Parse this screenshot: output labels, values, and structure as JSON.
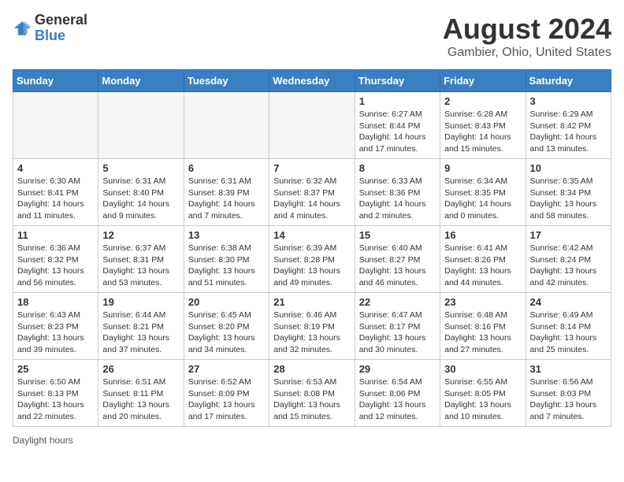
{
  "header": {
    "logo_general": "General",
    "logo_blue": "Blue",
    "main_title": "August 2024",
    "subtitle": "Gambier, Ohio, United States"
  },
  "footer": {
    "label": "Daylight hours"
  },
  "days_of_week": [
    "Sunday",
    "Monday",
    "Tuesday",
    "Wednesday",
    "Thursday",
    "Friday",
    "Saturday"
  ],
  "weeks": [
    [
      {
        "day": "",
        "info": ""
      },
      {
        "day": "",
        "info": ""
      },
      {
        "day": "",
        "info": ""
      },
      {
        "day": "",
        "info": ""
      },
      {
        "day": "1",
        "info": "Sunrise: 6:27 AM\nSunset: 8:44 PM\nDaylight: 14 hours and 17 minutes."
      },
      {
        "day": "2",
        "info": "Sunrise: 6:28 AM\nSunset: 8:43 PM\nDaylight: 14 hours and 15 minutes."
      },
      {
        "day": "3",
        "info": "Sunrise: 6:29 AM\nSunset: 8:42 PM\nDaylight: 14 hours and 13 minutes."
      }
    ],
    [
      {
        "day": "4",
        "info": "Sunrise: 6:30 AM\nSunset: 8:41 PM\nDaylight: 14 hours and 11 minutes."
      },
      {
        "day": "5",
        "info": "Sunrise: 6:31 AM\nSunset: 8:40 PM\nDaylight: 14 hours and 9 minutes."
      },
      {
        "day": "6",
        "info": "Sunrise: 6:31 AM\nSunset: 8:39 PM\nDaylight: 14 hours and 7 minutes."
      },
      {
        "day": "7",
        "info": "Sunrise: 6:32 AM\nSunset: 8:37 PM\nDaylight: 14 hours and 4 minutes."
      },
      {
        "day": "8",
        "info": "Sunrise: 6:33 AM\nSunset: 8:36 PM\nDaylight: 14 hours and 2 minutes."
      },
      {
        "day": "9",
        "info": "Sunrise: 6:34 AM\nSunset: 8:35 PM\nDaylight: 14 hours and 0 minutes."
      },
      {
        "day": "10",
        "info": "Sunrise: 6:35 AM\nSunset: 8:34 PM\nDaylight: 13 hours and 58 minutes."
      }
    ],
    [
      {
        "day": "11",
        "info": "Sunrise: 6:36 AM\nSunset: 8:32 PM\nDaylight: 13 hours and 56 minutes."
      },
      {
        "day": "12",
        "info": "Sunrise: 6:37 AM\nSunset: 8:31 PM\nDaylight: 13 hours and 53 minutes."
      },
      {
        "day": "13",
        "info": "Sunrise: 6:38 AM\nSunset: 8:30 PM\nDaylight: 13 hours and 51 minutes."
      },
      {
        "day": "14",
        "info": "Sunrise: 6:39 AM\nSunset: 8:28 PM\nDaylight: 13 hours and 49 minutes."
      },
      {
        "day": "15",
        "info": "Sunrise: 6:40 AM\nSunset: 8:27 PM\nDaylight: 13 hours and 46 minutes."
      },
      {
        "day": "16",
        "info": "Sunrise: 6:41 AM\nSunset: 8:26 PM\nDaylight: 13 hours and 44 minutes."
      },
      {
        "day": "17",
        "info": "Sunrise: 6:42 AM\nSunset: 8:24 PM\nDaylight: 13 hours and 42 minutes."
      }
    ],
    [
      {
        "day": "18",
        "info": "Sunrise: 6:43 AM\nSunset: 8:23 PM\nDaylight: 13 hours and 39 minutes."
      },
      {
        "day": "19",
        "info": "Sunrise: 6:44 AM\nSunset: 8:21 PM\nDaylight: 13 hours and 37 minutes."
      },
      {
        "day": "20",
        "info": "Sunrise: 6:45 AM\nSunset: 8:20 PM\nDaylight: 13 hours and 34 minutes."
      },
      {
        "day": "21",
        "info": "Sunrise: 6:46 AM\nSunset: 8:19 PM\nDaylight: 13 hours and 32 minutes."
      },
      {
        "day": "22",
        "info": "Sunrise: 6:47 AM\nSunset: 8:17 PM\nDaylight: 13 hours and 30 minutes."
      },
      {
        "day": "23",
        "info": "Sunrise: 6:48 AM\nSunset: 8:16 PM\nDaylight: 13 hours and 27 minutes."
      },
      {
        "day": "24",
        "info": "Sunrise: 6:49 AM\nSunset: 8:14 PM\nDaylight: 13 hours and 25 minutes."
      }
    ],
    [
      {
        "day": "25",
        "info": "Sunrise: 6:50 AM\nSunset: 8:13 PM\nDaylight: 13 hours and 22 minutes."
      },
      {
        "day": "26",
        "info": "Sunrise: 6:51 AM\nSunset: 8:11 PM\nDaylight: 13 hours and 20 minutes."
      },
      {
        "day": "27",
        "info": "Sunrise: 6:52 AM\nSunset: 8:09 PM\nDaylight: 13 hours and 17 minutes."
      },
      {
        "day": "28",
        "info": "Sunrise: 6:53 AM\nSunset: 8:08 PM\nDaylight: 13 hours and 15 minutes."
      },
      {
        "day": "29",
        "info": "Sunrise: 6:54 AM\nSunset: 8:06 PM\nDaylight: 13 hours and 12 minutes."
      },
      {
        "day": "30",
        "info": "Sunrise: 6:55 AM\nSunset: 8:05 PM\nDaylight: 13 hours and 10 minutes."
      },
      {
        "day": "31",
        "info": "Sunrise: 6:56 AM\nSunset: 8:03 PM\nDaylight: 13 hours and 7 minutes."
      }
    ]
  ]
}
